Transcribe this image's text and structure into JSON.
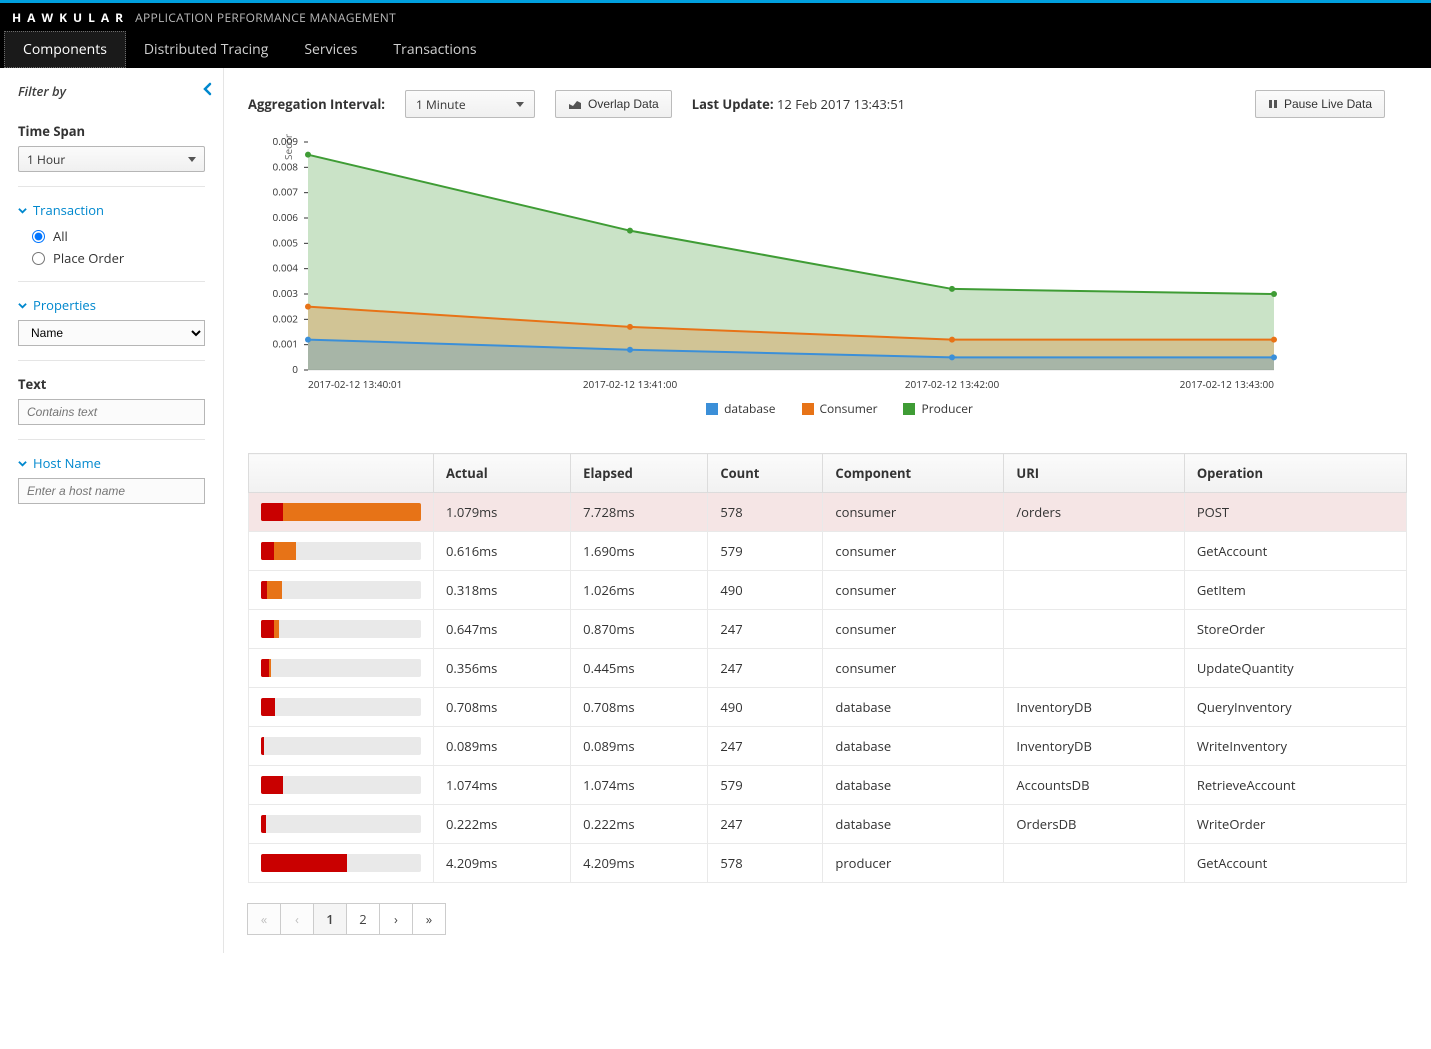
{
  "header": {
    "brand": "HAWKULAR",
    "subtitle": "APPLICATION PERFORMANCE MANAGEMENT"
  },
  "nav": {
    "items": [
      {
        "label": "Components",
        "active": true
      },
      {
        "label": "Distributed Tracing",
        "active": false
      },
      {
        "label": "Services",
        "active": false
      },
      {
        "label": "Transactions",
        "active": false
      }
    ]
  },
  "sidebar": {
    "filter_by_label": "Filter by",
    "timespan_label": "Time Span",
    "timespan_value": "1 Hour",
    "transaction_label": "Transaction",
    "transaction_options": [
      {
        "label": "All",
        "selected": true
      },
      {
        "label": "Place Order",
        "selected": false
      }
    ],
    "properties_label": "Properties",
    "properties_value": "Name",
    "text_label": "Text",
    "text_placeholder": "Contains text",
    "hostname_label": "Host Name",
    "hostname_placeholder": "Enter a host name"
  },
  "controls": {
    "agg_interval_label": "Aggregation Interval:",
    "agg_interval_value": "1 Minute",
    "overlap_label": "Overlap Data",
    "last_update_label": "Last Update:",
    "last_update_value": "12 Feb 2017 13:43:51",
    "pause_label": "Pause Live Data"
  },
  "chart_data": {
    "type": "area",
    "ylabel": "Seconds",
    "ylim": [
      0,
      0.009
    ],
    "yticks": [
      0,
      0.001,
      0.002,
      0.003,
      0.004,
      0.005,
      0.006,
      0.007,
      0.008,
      0.009
    ],
    "categories": [
      "2017-02-12 13:40:01",
      "2017-02-12 13:41:00",
      "2017-02-12 13:42:00",
      "2017-02-12 13:43:00"
    ],
    "series": [
      {
        "name": "database",
        "color": "#3b8fd8",
        "values": [
          0.0012,
          0.0008,
          0.0005,
          0.0005
        ]
      },
      {
        "name": "Consumer",
        "color": "#e77317",
        "values": [
          0.0025,
          0.0017,
          0.0012,
          0.0012
        ]
      },
      {
        "name": "Producer",
        "color": "#3f9c35",
        "values": [
          0.0085,
          0.0055,
          0.0032,
          0.003
        ]
      }
    ]
  },
  "table": {
    "columns": [
      "",
      "Actual",
      "Elapsed",
      "Count",
      "Component",
      "URI",
      "Operation"
    ],
    "rows": [
      {
        "bar_red": 14,
        "bar_orange": 100,
        "actual": "1.079ms",
        "elapsed": "7.728ms",
        "count": "578",
        "component": "consumer",
        "uri": "/orders",
        "operation": "POST",
        "highlight": true
      },
      {
        "bar_red": 8,
        "bar_orange": 22,
        "actual": "0.616ms",
        "elapsed": "1.690ms",
        "count": "579",
        "component": "consumer",
        "uri": "",
        "operation": "GetAccount"
      },
      {
        "bar_red": 4,
        "bar_orange": 13,
        "actual": "0.318ms",
        "elapsed": "1.026ms",
        "count": "490",
        "component": "consumer",
        "uri": "",
        "operation": "GetItem"
      },
      {
        "bar_red": 8,
        "bar_orange": 11,
        "actual": "0.647ms",
        "elapsed": "0.870ms",
        "count": "247",
        "component": "consumer",
        "uri": "",
        "operation": "StoreOrder"
      },
      {
        "bar_red": 5,
        "bar_orange": 6,
        "actual": "0.356ms",
        "elapsed": "0.445ms",
        "count": "247",
        "component": "consumer",
        "uri": "",
        "operation": "UpdateQuantity"
      },
      {
        "bar_red": 9,
        "bar_orange": 0,
        "actual": "0.708ms",
        "elapsed": "0.708ms",
        "count": "490",
        "component": "database",
        "uri": "InventoryDB",
        "operation": "QueryInventory"
      },
      {
        "bar_red": 2,
        "bar_orange": 0,
        "actual": "0.089ms",
        "elapsed": "0.089ms",
        "count": "247",
        "component": "database",
        "uri": "InventoryDB",
        "operation": "WriteInventory"
      },
      {
        "bar_red": 14,
        "bar_orange": 0,
        "actual": "1.074ms",
        "elapsed": "1.074ms",
        "count": "579",
        "component": "database",
        "uri": "AccountsDB",
        "operation": "RetrieveAccount"
      },
      {
        "bar_red": 3,
        "bar_orange": 0,
        "actual": "0.222ms",
        "elapsed": "0.222ms",
        "count": "247",
        "component": "database",
        "uri": "OrdersDB",
        "operation": "WriteOrder"
      },
      {
        "bar_red": 54,
        "bar_orange": 0,
        "actual": "4.209ms",
        "elapsed": "4.209ms",
        "count": "578",
        "component": "producer",
        "uri": "",
        "operation": "GetAccount"
      }
    ]
  },
  "pagination": {
    "first": "«",
    "prev": "‹",
    "next": "›",
    "last": "»",
    "pages": [
      "1",
      "2"
    ],
    "active": "1"
  }
}
